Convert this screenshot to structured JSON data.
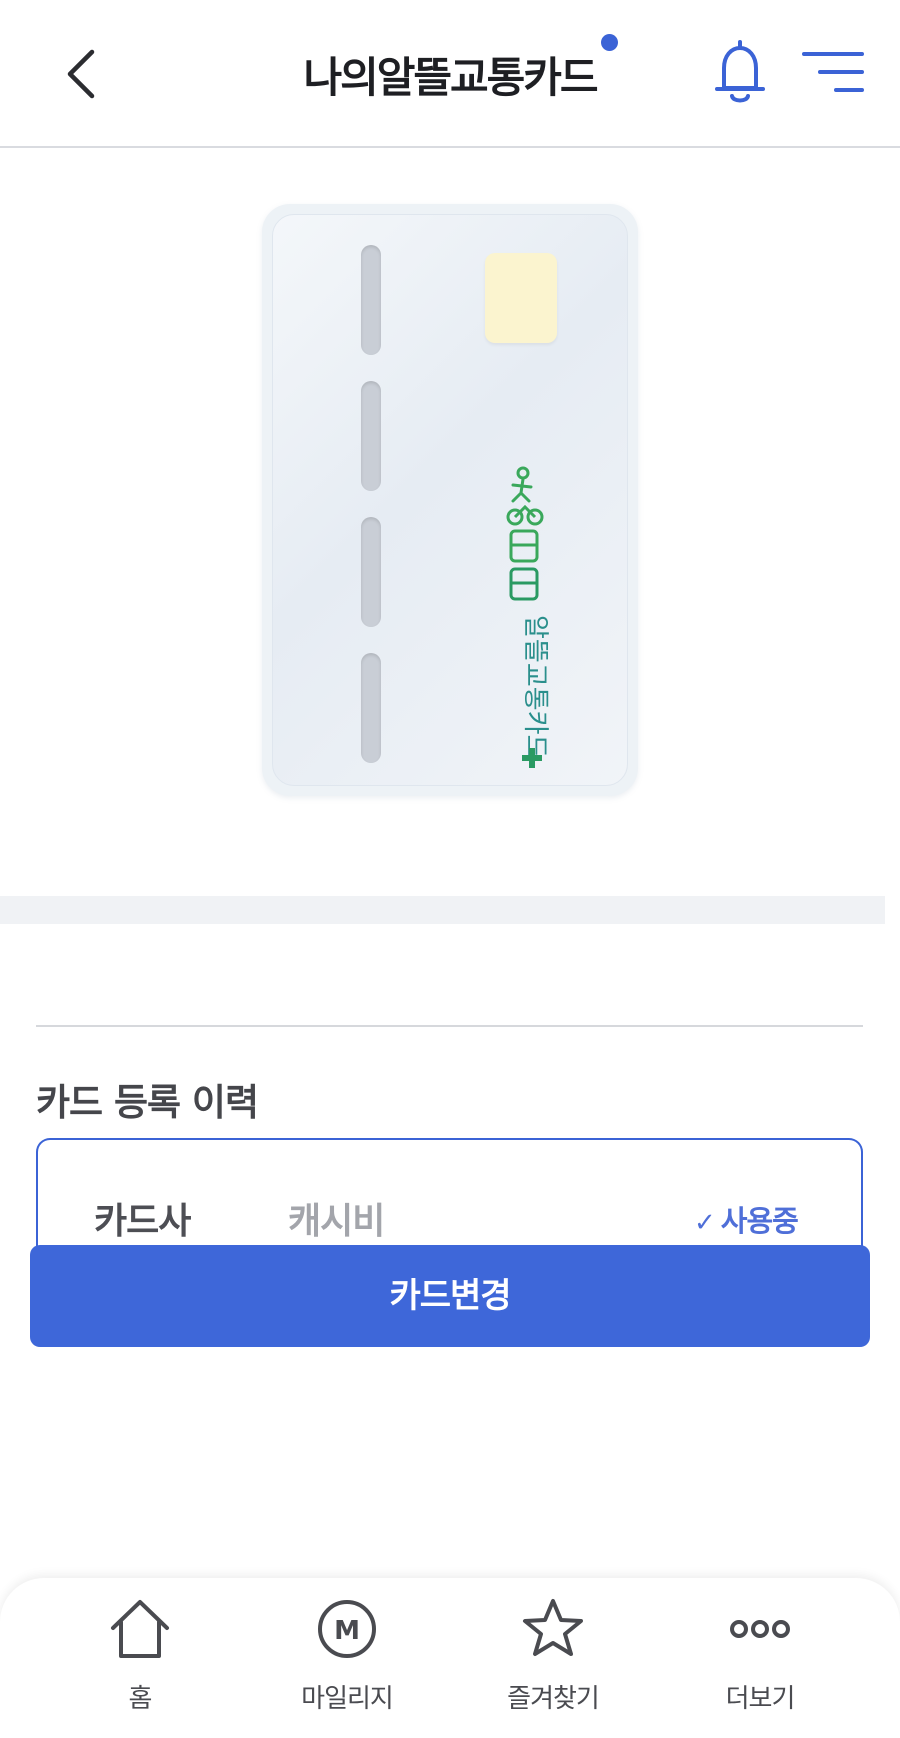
{
  "header": {
    "title": "나의알뜰교통카드",
    "back_icon": "chevron-left-icon",
    "notification_icon": "bell-icon",
    "menu_icon": "menu-icon",
    "accent_color": "#3b63d6"
  },
  "card": {
    "logo_text": "알뜰교통카드"
  },
  "history": {
    "section_title": "카드 등록 이력",
    "company_label": "카드사",
    "company_value": "캐시비",
    "status": "사용중"
  },
  "actions": {
    "change_card": "카드변경"
  },
  "bottom_nav": [
    {
      "label": "홈",
      "icon": "home-icon"
    },
    {
      "label": "마일리지",
      "icon": "mileage-icon"
    },
    {
      "label": "즐겨찾기",
      "icon": "star-icon"
    },
    {
      "label": "더보기",
      "icon": "more-icon"
    }
  ]
}
